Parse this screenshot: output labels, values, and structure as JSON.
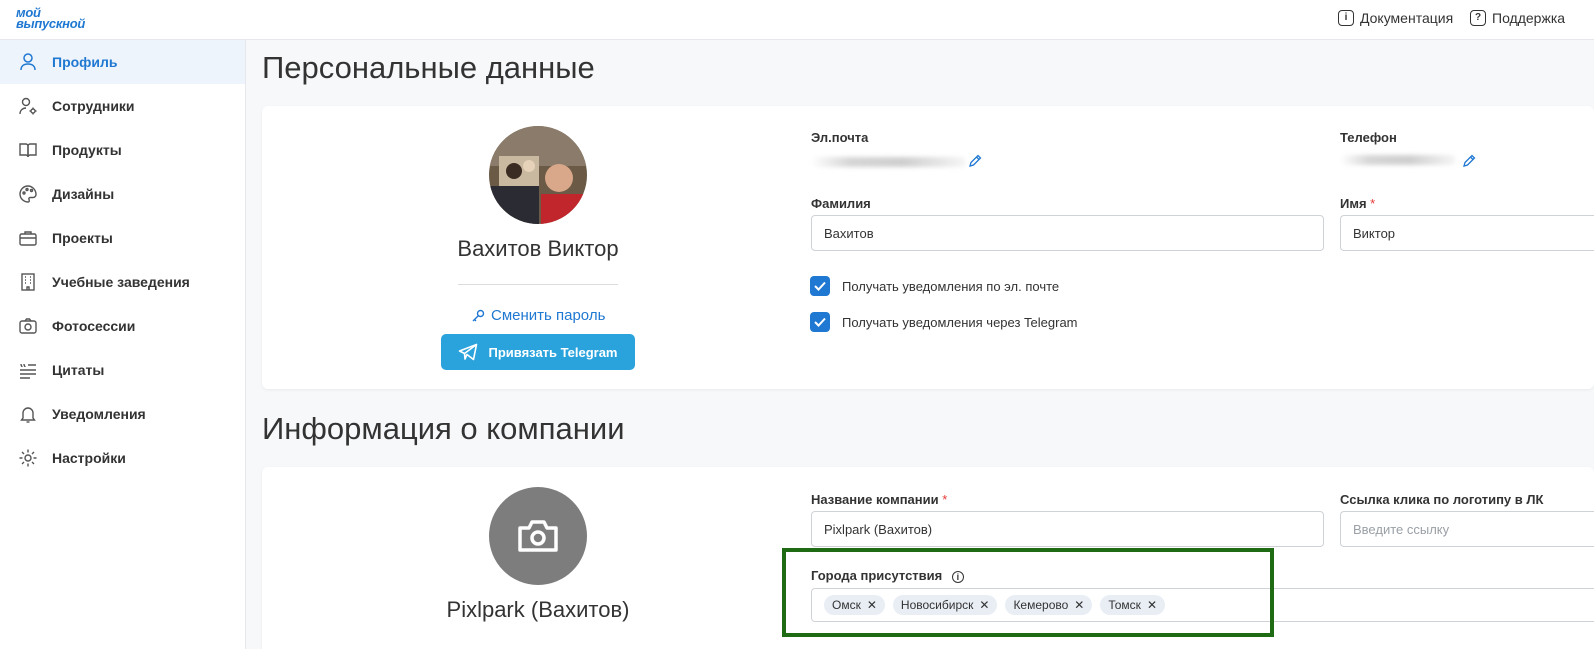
{
  "header": {
    "logo_line1": "мой",
    "logo_line2": "выпускной",
    "docs_label": "Документация",
    "support_label": "Поддержка"
  },
  "sidebar": {
    "items": [
      {
        "label": "Профиль",
        "icon": "user-icon",
        "active": true
      },
      {
        "label": "Сотрудники",
        "icon": "user-gear-icon"
      },
      {
        "label": "Продукты",
        "icon": "book-icon"
      },
      {
        "label": "Дизайны",
        "icon": "palette-icon"
      },
      {
        "label": "Проекты",
        "icon": "briefcase-icon"
      },
      {
        "label": "Учебные заведения",
        "icon": "building-icon"
      },
      {
        "label": "Фотосессии",
        "icon": "camera-icon"
      },
      {
        "label": "Цитаты",
        "icon": "quote-icon"
      },
      {
        "label": "Уведомления",
        "icon": "bell-icon"
      },
      {
        "label": "Настройки",
        "icon": "gear-icon"
      }
    ]
  },
  "personal": {
    "section_title": "Персональные данные",
    "full_name": "Вахитов Виктор",
    "change_password": "Сменить пароль",
    "telegram_button": "Привязать Telegram",
    "email_label": "Эл.почта",
    "phone_label": "Телефон",
    "lastname_label": "Фамилия",
    "lastname_value": "Вахитов",
    "firstname_label": "Имя",
    "firstname_value": "Виктор",
    "required_mark": "*",
    "notify_email": "Получать уведомления по эл. почте",
    "notify_telegram": "Получать уведомления через Telegram"
  },
  "company": {
    "section_title": "Информация о компании",
    "name_display": "Pixlpark (Вахитов)",
    "name_label": "Название компании",
    "name_value": "Pixlpark (Вахитов)",
    "logo_link_label": "Ссылка клика по логотипу в ЛК",
    "logo_link_placeholder": "Введите ссылку",
    "cities_label": "Города присутствия",
    "cities": [
      "Омск",
      "Новосибирск",
      "Кемерово",
      "Томск"
    ]
  },
  "colors": {
    "accent": "#1f78d1",
    "telegram": "#2aa3dd",
    "highlight": "#1e6b14"
  }
}
